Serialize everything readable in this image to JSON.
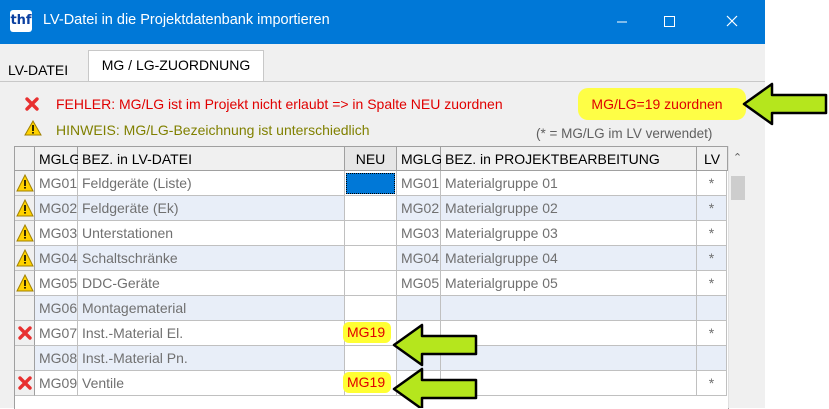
{
  "window": {
    "title": "LV-Datei in die Projektdatenbank importieren",
    "app_icon_text": "thf"
  },
  "tabs": [
    {
      "label": "LV-DATEI"
    },
    {
      "label": "MG / LG-ZUORDNUNG",
      "active": true
    }
  ],
  "messages": {
    "error": "FEHLER: MG/LG ist im Projekt nicht erlaubt => in Spalte NEU zuordnen",
    "warning": "HINWEIS: MG/LG-Bezeichnung ist unterschiedlich",
    "legend": "(* = MG/LG im LV verwendet)"
  },
  "assign_button_label": "MG/LG=19 zuordnen",
  "columns": [
    "MGLG",
    "BEZ. in LV-DATEI",
    "NEU",
    "MGLG",
    "BEZ. in PROJEKTBEARBEITUNG",
    "LV"
  ],
  "rows": [
    {
      "status": "warning",
      "mglg": "MG01",
      "bez": "Feldgeräte (Liste)",
      "neu": "",
      "mglg2": "MG01",
      "bez2": "Materialgruppe 01",
      "lv": "*"
    },
    {
      "status": "warning",
      "mglg": "MG02",
      "bez": "Feldgeräte (Ek)",
      "neu": "",
      "mglg2": "MG02",
      "bez2": "Materialgruppe 02",
      "lv": "*"
    },
    {
      "status": "warning",
      "mglg": "MG03",
      "bez": "Unterstationen",
      "neu": "",
      "mglg2": "MG03",
      "bez2": "Materialgruppe 03",
      "lv": "*"
    },
    {
      "status": "warning",
      "mglg": "MG04",
      "bez": "Schaltschränke",
      "neu": "",
      "mglg2": "MG04",
      "bez2": "Materialgruppe 04",
      "lv": "*"
    },
    {
      "status": "warning",
      "mglg": "MG05",
      "bez": "DDC-Geräte",
      "neu": "",
      "mglg2": "MG05",
      "bez2": "Materialgruppe 05",
      "lv": "*"
    },
    {
      "status": "",
      "mglg": "MG06",
      "bez": "Montagematerial",
      "neu": "",
      "mglg2": "",
      "bez2": "",
      "lv": ""
    },
    {
      "status": "error",
      "mglg": "MG07",
      "bez": "Inst.-Material El.",
      "neu": "MG19",
      "mglg2": "",
      "bez2": "",
      "lv": "*"
    },
    {
      "status": "",
      "mglg": "MG08",
      "bez": "Inst.-Material Pn.",
      "neu": "",
      "mglg2": "",
      "bez2": "",
      "lv": ""
    },
    {
      "status": "error",
      "mglg": "MG09",
      "bez": "Ventile",
      "neu": "MG19",
      "mglg2": "",
      "bez2": "",
      "lv": "*"
    }
  ],
  "colors": {
    "titlebar": "#0078d7",
    "error": "#e00000",
    "warning": "#808000",
    "highlight": "#ffff33",
    "arrow_fill": "#b5e61d"
  }
}
